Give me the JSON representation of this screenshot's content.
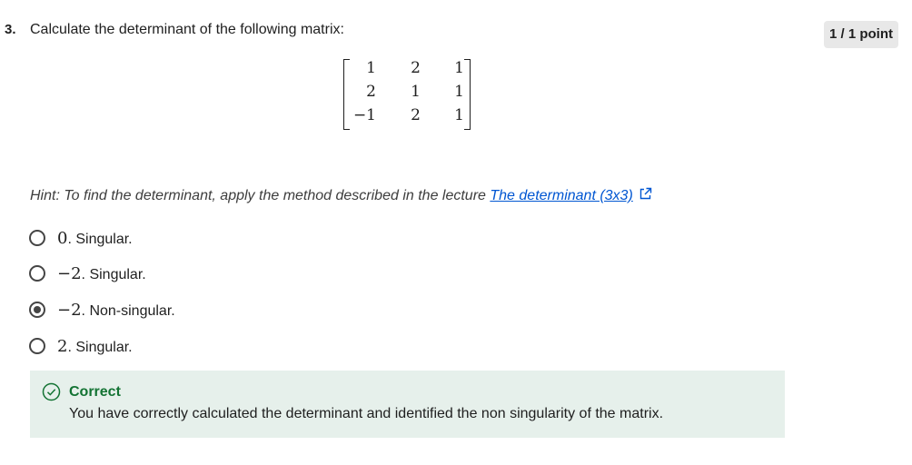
{
  "question": {
    "number": "3.",
    "text": "Calculate the determinant of the following matrix:",
    "points": "1 / 1 point"
  },
  "matrix": {
    "rows": [
      [
        "1",
        "2",
        "1"
      ],
      [
        "2",
        "1",
        "1"
      ],
      [
        "−1",
        "2",
        "1"
      ]
    ]
  },
  "hint": {
    "text": "Hint: To find the determinant, apply the method described in the lecture ",
    "link_text": "The determinant (3x3)"
  },
  "options": [
    {
      "value": "0",
      "label": ". Singular.",
      "selected": false
    },
    {
      "value": "−2",
      "label": ". Singular.",
      "selected": false
    },
    {
      "value": "−2",
      "label": ". Non-singular.",
      "selected": true
    },
    {
      "value": "2",
      "label": ". Singular.",
      "selected": false
    }
  ],
  "feedback": {
    "title": "Correct",
    "text": "You have correctly calculated the determinant and identified the non singularity of the matrix.",
    "icon": "check-circle-icon",
    "color": "#137333"
  }
}
